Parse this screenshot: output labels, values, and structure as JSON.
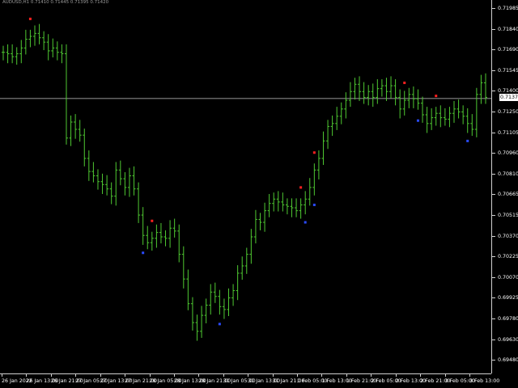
{
  "header": {
    "info": "AUDUSD,H1  0.71410 0.71445 0.71395 0.71420"
  },
  "price_axis": {
    "labels": [
      "0.71985",
      "0.71840",
      "0.71690",
      "0.71545",
      "0.71400",
      "0.71250",
      "0.71105",
      "0.70960",
      "0.70810",
      "0.70665",
      "0.70515",
      "0.70370",
      "0.70225",
      "0.70070",
      "0.69925",
      "0.69780",
      "0.69630",
      "0.69480"
    ],
    "current_price": "0.71372"
  },
  "time_axis": {
    "labels": [
      "26 Jan 2022",
      "26 Jan 13:00",
      "26 Jan 21:00",
      "27 Jan 05:00",
      "27 Jan 13:00",
      "27 Jan 21:00",
      "28 Jan 05:00",
      "28 Jan 13:00",
      "28 Jan 21:00",
      "31 Jan 05:00",
      "31 Jan 13:00",
      "31 Jan 21:00",
      "1 Feb 05:00",
      "1 Feb 13:00",
      "1 Feb 21:00",
      "2 Feb 05:00",
      "2 Feb 13:00",
      "2 Feb 21:00",
      "3 Feb 05:00",
      "3 Feb 13:00"
    ]
  },
  "colors": {
    "background": "#000000",
    "bar": "#4fc932",
    "grid_axis": "#cfcfcf",
    "sell_signal": "#ff2020",
    "buy_signal": "#2a4bff",
    "price_line": "#c8c8c8"
  },
  "chart_data": {
    "type": "ohlc",
    "ylim": [
      0.6948,
      0.7205
    ],
    "current_price": 0.71372,
    "series": [
      {
        "kind": "close",
        "values": [
          0.7169,
          0.7168,
          0.7166,
          0.7168,
          0.7172,
          0.7178,
          0.718,
          0.7182,
          0.7179,
          0.7176,
          0.717,
          0.7172,
          0.7169,
          0.7168,
          0.711,
          0.7121,
          0.7116,
          0.7112,
          0.7096,
          0.7087,
          0.7084,
          0.708,
          0.7078,
          0.7075,
          0.707,
          0.7088,
          0.7082,
          0.7076,
          0.7084,
          0.7075,
          0.7057,
          0.7043,
          0.7038,
          0.7041,
          0.7045,
          0.7042,
          0.7041,
          0.7048,
          0.7046,
          0.703,
          0.7013,
          0.6996,
          0.6983,
          0.6977,
          0.6988,
          0.6995,
          0.7004,
          0.7001,
          0.6994,
          0.6992,
          0.7,
          0.7005,
          0.7017,
          0.7022,
          0.703,
          0.7042,
          0.7054,
          0.7052,
          0.706,
          0.7065,
          0.7068,
          0.7066,
          0.7064,
          0.7063,
          0.7062,
          0.706,
          0.7064,
          0.7068,
          0.7076,
          0.7088,
          0.7096,
          0.7108,
          0.7118,
          0.712,
          0.7125,
          0.713,
          0.7136,
          0.7142,
          0.7147,
          0.7142,
          0.7138,
          0.7142,
          0.7138,
          0.7144,
          0.7146,
          0.7142,
          0.7146,
          0.7138,
          0.713,
          0.7136,
          0.714,
          0.7137,
          0.7134,
          0.7126,
          0.712,
          0.7124,
          0.7127,
          0.7124,
          0.7123,
          0.7127,
          0.713,
          0.7128,
          0.7125,
          0.712,
          0.7116,
          0.714,
          0.7148,
          0.7138
        ]
      }
    ],
    "sell_signal_indices": [
      6,
      33,
      66,
      69,
      89,
      96
    ],
    "buy_signal_indices": [
      31,
      48,
      67,
      69,
      92,
      103
    ]
  }
}
